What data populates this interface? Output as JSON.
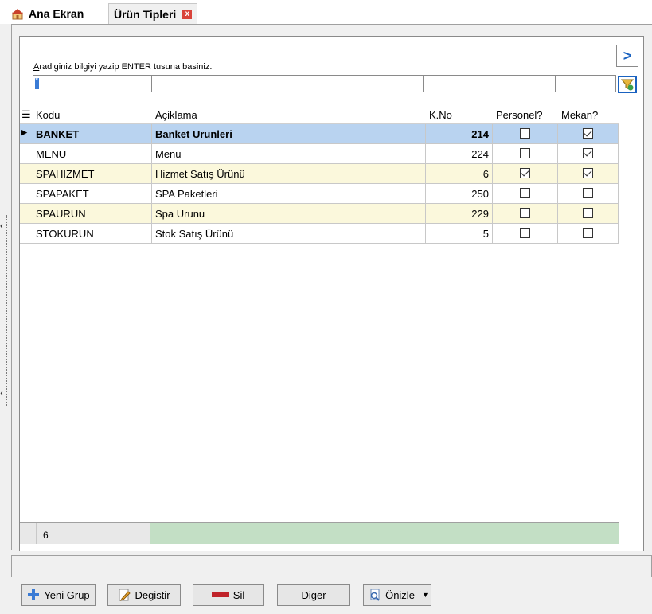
{
  "tabs": [
    {
      "label": "Ana Ekran"
    },
    {
      "label": "Ürün Tipleri",
      "close": "x"
    }
  ],
  "filter": {
    "hint_first": "A",
    "hint_rest": "radiginiz bilgiyi yazip ENTER tusuna basiniz.",
    "nav_label": ">",
    "active_value": "*"
  },
  "grid": {
    "headers": {
      "kodu": "Kodu",
      "aciklama": "Açiklama",
      "kno": "K.No",
      "personel": "Personel?",
      "mekan": "Mekan?"
    },
    "rows": [
      {
        "kodu": "BANKET",
        "aciklama": "Banket Urunleri",
        "kno": "214",
        "personel": false,
        "mekan": true,
        "selected": true
      },
      {
        "kodu": "MENU",
        "aciklama": "Menu",
        "kno": "224",
        "personel": false,
        "mekan": true
      },
      {
        "kodu": "SPAHIZMET",
        "aciklama": "Hizmet Satış Ürünü",
        "kno": "6",
        "personel": true,
        "mekan": true
      },
      {
        "kodu": "SPAPAKET",
        "aciklama": "SPA Paketleri",
        "kno": "250",
        "personel": false,
        "mekan": false
      },
      {
        "kodu": "SPAURUN",
        "aciklama": "Spa Urunu",
        "kno": "229",
        "personel": false,
        "mekan": false
      },
      {
        "kodu": "STOKURUN",
        "aciklama": "Stok Satış Ürünü",
        "kno": "5",
        "personel": false,
        "mekan": false
      }
    ],
    "footer_count": "6"
  },
  "buttons": {
    "yeni_u": "Y",
    "yeni_rest": "eni Grup",
    "degistir_u": "D",
    "degistir_rest": "egistir",
    "sil_pre": "S",
    "sil_u": "i",
    "sil_rest": "l",
    "diger_pre": "Di",
    "diger_u": "g",
    "diger_rest": "er",
    "onizle_u": "Ö",
    "onizle_rest": "nizle"
  },
  "colors": {
    "selected_row": "#b9d3f0",
    "alt_row": "#fbf8dc",
    "footer_green": "#c3dfc5",
    "accent": "#1a62c0"
  }
}
